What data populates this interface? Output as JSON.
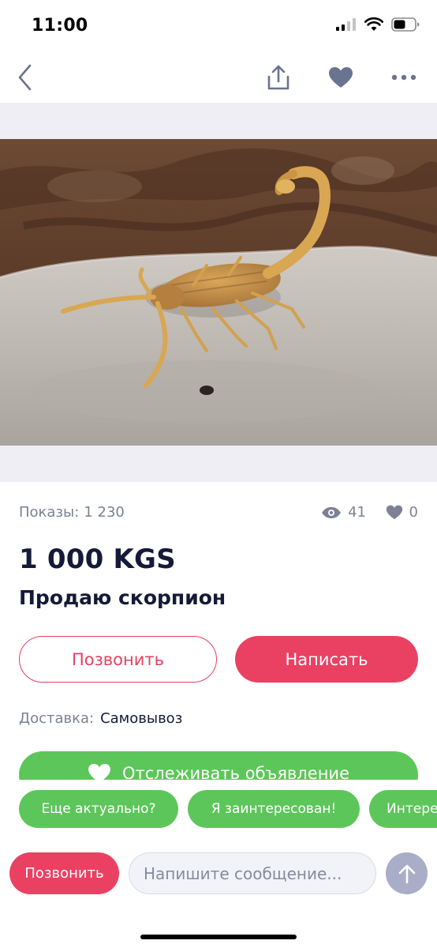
{
  "status_bar": {
    "time": "11:00"
  },
  "ad": {
    "views_label": "Показы:",
    "views_value": "1 230",
    "eye_count": "41",
    "fav_count": "0",
    "price": "1 000 KGS",
    "title": "Продаю скорпион",
    "delivery_label": "Доставка:",
    "delivery_value": "Самовывоз"
  },
  "actions": {
    "call_label": "Позвонить",
    "write_label": "Написать",
    "track_label": "Отслеживать объявление"
  },
  "quick_replies": [
    {
      "label": "Еще актуально?"
    },
    {
      "label": "Я заинтересован!"
    },
    {
      "label": "Интересно"
    }
  ],
  "composer": {
    "call_label": "Позвонить",
    "placeholder": "Напишите сообщение..."
  },
  "icons": {
    "back": "chevron-left-icon",
    "share": "share-icon",
    "favorite": "heart-icon",
    "more": "more-icon",
    "eye": "eye-icon",
    "send": "arrow-up-icon"
  },
  "colors": {
    "accent_red": "#ea4163",
    "accent_green": "#5dc65a",
    "nav_icon": "#6a7390"
  }
}
